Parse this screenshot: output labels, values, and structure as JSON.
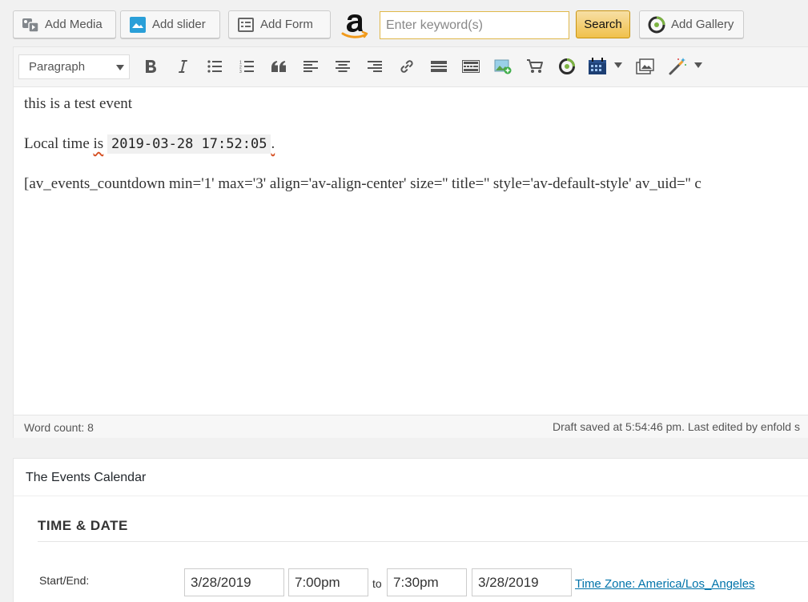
{
  "media_buttons": {
    "add_media": "Add Media",
    "add_slider": "Add slider",
    "add_form": "Add Form",
    "search_placeholder": "Enter keyword(s)",
    "search_label": "Search",
    "add_gallery": "Add Gallery"
  },
  "toolbar": {
    "format_value": "Paragraph"
  },
  "content": {
    "line1": "this is a test event",
    "line2_prefix": "Local time ",
    "line2_spell": "is",
    "line2_code": "2019-03-28 17:52:05",
    "line2_suffix": ".",
    "line3": "[av_events_countdown min='1' max='3' align='av-align-center' size='' title='' style='av-default-style' av_uid='' c"
  },
  "status": {
    "word_count": "Word count: 8",
    "draft_saved": "Draft saved at 5:54:46 pm. Last edited by enfold s"
  },
  "events_calendar": {
    "title": "The Events Calendar",
    "section": "TIME & DATE",
    "start_end_label": "Start/End:",
    "start_date": "3/28/2019",
    "start_time": "7:00pm",
    "to_label": "to",
    "end_time": "7:30pm",
    "end_date": "3/28/2019",
    "timezone_link": "Time Zone: America/Los_Angeles"
  },
  "colors": {
    "accent_link": "#0073aa",
    "search_button": "#f0c14b",
    "spell_underline": "#d54e21"
  }
}
